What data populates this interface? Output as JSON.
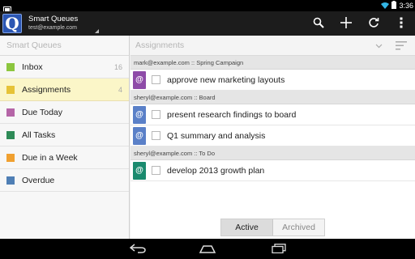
{
  "status_bar": {
    "time": "3:36",
    "icons": [
      "notification-icon",
      "wifi-icon",
      "battery-icon"
    ]
  },
  "action_bar": {
    "app_title": "Smart Queues",
    "account": "test@example.com",
    "logo_letter": "Q",
    "actions": [
      "search-icon",
      "add-icon",
      "refresh-icon",
      "overflow-menu-icon"
    ]
  },
  "sidebar": {
    "header": "Smart Queues",
    "items": [
      {
        "label": "Inbox",
        "count": "16",
        "color": "#8cc63f"
      },
      {
        "label": "Assignments",
        "count": "4",
        "color": "#e6c337",
        "selected": true
      },
      {
        "label": "Due Today",
        "count": "",
        "color": "#b565a7"
      },
      {
        "label": "All Tasks",
        "count": "",
        "color": "#2e8b57"
      },
      {
        "label": "Due in a Week",
        "count": "",
        "color": "#f0a030"
      },
      {
        "label": "Overdue",
        "count": "",
        "color": "#4f7fb5"
      }
    ]
  },
  "main": {
    "header": "Assignments",
    "groups": [
      {
        "title": "mark@example.com :: Spring Campaign",
        "tasks": [
          {
            "title": "approve new marketing layouts",
            "badge": "@",
            "color": "#8e4ba8"
          }
        ]
      },
      {
        "title": "sheryl@example.com :: Board",
        "tasks": [
          {
            "title": "present research findings to board",
            "badge": "@",
            "color": "#5a80c8"
          },
          {
            "title": "Q1 summary and analysis",
            "badge": "@",
            "color": "#5a80c8"
          }
        ]
      },
      {
        "title": "sheryl@example.com :: To Do",
        "tasks": [
          {
            "title": "develop 2013 growth plan",
            "badge": "@",
            "color": "#1a8a6e"
          }
        ]
      }
    ],
    "toggle": {
      "active": "Active",
      "archived": "Archived"
    }
  },
  "nav_bar": [
    "back-icon",
    "home-icon",
    "recent-apps-icon"
  ]
}
